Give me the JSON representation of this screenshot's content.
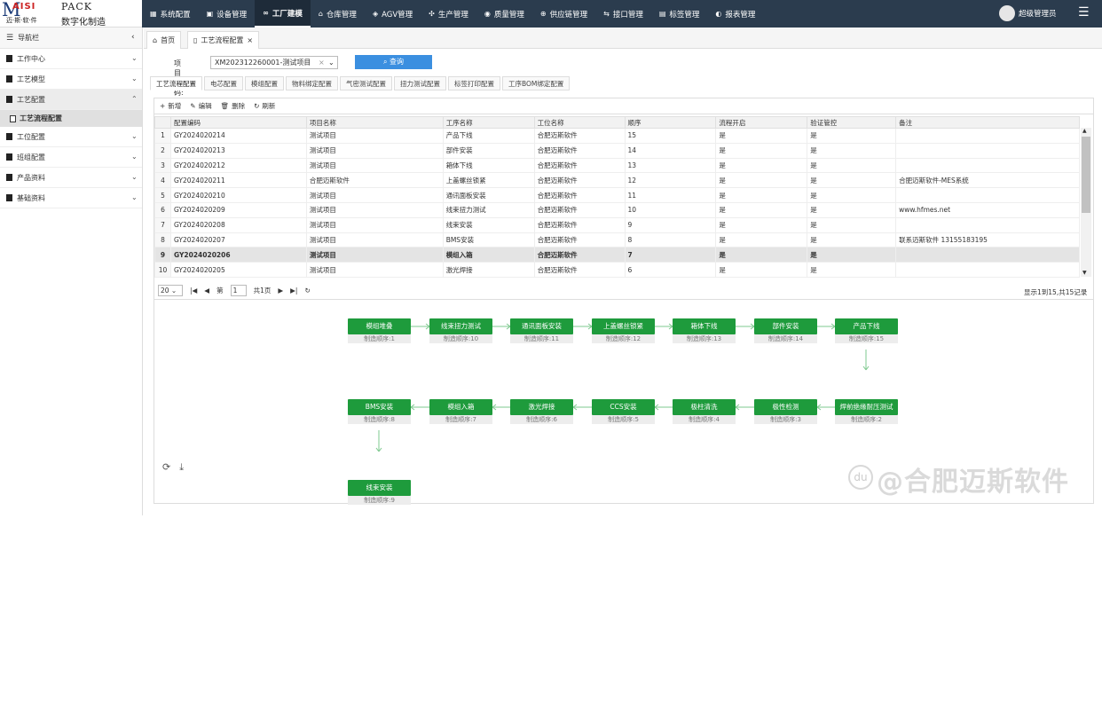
{
  "logo": {
    "m": "M",
    "brand": "AISI",
    "pack": "PACK",
    "cn1": "迈·斯·软·件",
    "cn2": "数字化制造"
  },
  "nav": [
    {
      "icon": "▦",
      "label": "系统配置",
      "active": false
    },
    {
      "icon": "▣",
      "label": "设备管理",
      "active": false
    },
    {
      "icon": "∞",
      "label": "工厂建模",
      "active": true
    },
    {
      "icon": "⌂",
      "label": "仓库管理",
      "active": false
    },
    {
      "icon": "◈",
      "label": "AGV管理",
      "active": false
    },
    {
      "icon": "✣",
      "label": "生产管理",
      "active": false
    },
    {
      "icon": "◉",
      "label": "质量管理",
      "active": false
    },
    {
      "icon": "⊕",
      "label": "供应链管理",
      "active": false
    },
    {
      "icon": "⇆",
      "label": "接口管理",
      "active": false
    },
    {
      "icon": "▤",
      "label": "标签管理",
      "active": false
    },
    {
      "icon": "◐",
      "label": "报表管理",
      "active": false
    }
  ],
  "user": {
    "name": "超级管理员"
  },
  "sidebar": {
    "title": "导航栏",
    "items": [
      {
        "label": "工作中心"
      },
      {
        "label": "工艺模型"
      },
      {
        "label": "工艺配置",
        "open": true
      },
      {
        "label": "工位配置"
      },
      {
        "label": "班组配置"
      },
      {
        "label": "产品资料"
      },
      {
        "label": "基础资料"
      }
    ],
    "sub": "工艺流程配置"
  },
  "tabs": {
    "home": "首页",
    "current": "工艺流程配置"
  },
  "search": {
    "label": "项目编码:",
    "value": "XM202312260001-测试项目",
    "button": "查询"
  },
  "subtabs": [
    "工艺流程配置",
    "电芯配置",
    "模组配置",
    "物料绑定配置",
    "气密测试配置",
    "扭力测试配置",
    "标签打印配置",
    "工序BOM绑定配置"
  ],
  "toolbar": {
    "add": "新增",
    "edit": "编辑",
    "del": "删除",
    "refresh": "刷新"
  },
  "columns": [
    "配置编码",
    "项目名称",
    "工序名称",
    "工位名称",
    "顺序",
    "流程开启",
    "验证管控",
    "备注"
  ],
  "rows": [
    [
      "1",
      "GY2024020214",
      "测试项目",
      "产品下线",
      "合肥迈斯软件",
      "15",
      "是",
      "是",
      ""
    ],
    [
      "2",
      "GY2024020213",
      "测试项目",
      "部件安装",
      "合肥迈斯软件",
      "14",
      "是",
      "是",
      ""
    ],
    [
      "3",
      "GY2024020212",
      "测试项目",
      "箱体下线",
      "合肥迈斯软件",
      "13",
      "是",
      "是",
      ""
    ],
    [
      "4",
      "GY2024020211",
      "合肥迈斯软件",
      "上盖螺丝锁紧",
      "合肥迈斯软件",
      "12",
      "是",
      "是",
      "合肥迈斯软件-MES系统"
    ],
    [
      "5",
      "GY2024020210",
      "测试项目",
      "通讯面板安装",
      "合肥迈斯软件",
      "11",
      "是",
      "是",
      ""
    ],
    [
      "6",
      "GY2024020209",
      "测试项目",
      "线束扭力测试",
      "合肥迈斯软件",
      "10",
      "是",
      "是",
      "www.hfmes.net"
    ],
    [
      "7",
      "GY2024020208",
      "测试项目",
      "线束安装",
      "合肥迈斯软件",
      "9",
      "是",
      "是",
      ""
    ],
    [
      "8",
      "GY2024020207",
      "测试项目",
      "BMS安装",
      "合肥迈斯软件",
      "8",
      "是",
      "是",
      "联系迈斯软件 13155183195"
    ],
    [
      "9",
      "GY2024020206",
      "测试项目",
      "模组入箱",
      "合肥迈斯软件",
      "7",
      "是",
      "是",
      ""
    ],
    [
      "10",
      "GY2024020205",
      "测试项目",
      "激光焊接",
      "合肥迈斯软件",
      "6",
      "是",
      "是",
      ""
    ]
  ],
  "pager": {
    "size": "20",
    "page_prefix": "第",
    "page": "1",
    "total_pages": "共1页",
    "info": "显示1到15,共15记录"
  },
  "flow_row1": [
    {
      "name": "模组堆叠",
      "seq": "制造顺序:1"
    },
    {
      "name": "线束扭力测试",
      "seq": "制造顺序:10"
    },
    {
      "name": "通讯面板安装",
      "seq": "制造顺序:11"
    },
    {
      "name": "上盖螺丝锁紧",
      "seq": "制造顺序:12"
    },
    {
      "name": "箱体下线",
      "seq": "制造顺序:13"
    },
    {
      "name": "部件安装",
      "seq": "制造顺序:14"
    },
    {
      "name": "产品下线",
      "seq": "制造顺序:15"
    }
  ],
  "flow_row2": [
    {
      "name": "BMS安装",
      "seq": "制造顺序:8"
    },
    {
      "name": "模组入箱",
      "seq": "制造顺序:7"
    },
    {
      "name": "激光焊接",
      "seq": "制造顺序:6"
    },
    {
      "name": "CCS安装",
      "seq": "制造顺序:5"
    },
    {
      "name": "极柱清洗",
      "seq": "制造顺序:4"
    },
    {
      "name": "极性检测",
      "seq": "制造顺序:3"
    },
    {
      "name": "焊前绝缘耐压测试",
      "seq": "制造顺序:2"
    }
  ],
  "flow_row3": [
    {
      "name": "线束安装",
      "seq": "制造顺序:9"
    }
  ],
  "watermark": "@合肥迈斯软件",
  "colors": {
    "topbar": "#2b3c4e",
    "accent": "#3b8fe0",
    "flow_node": "#1e9b3c"
  }
}
